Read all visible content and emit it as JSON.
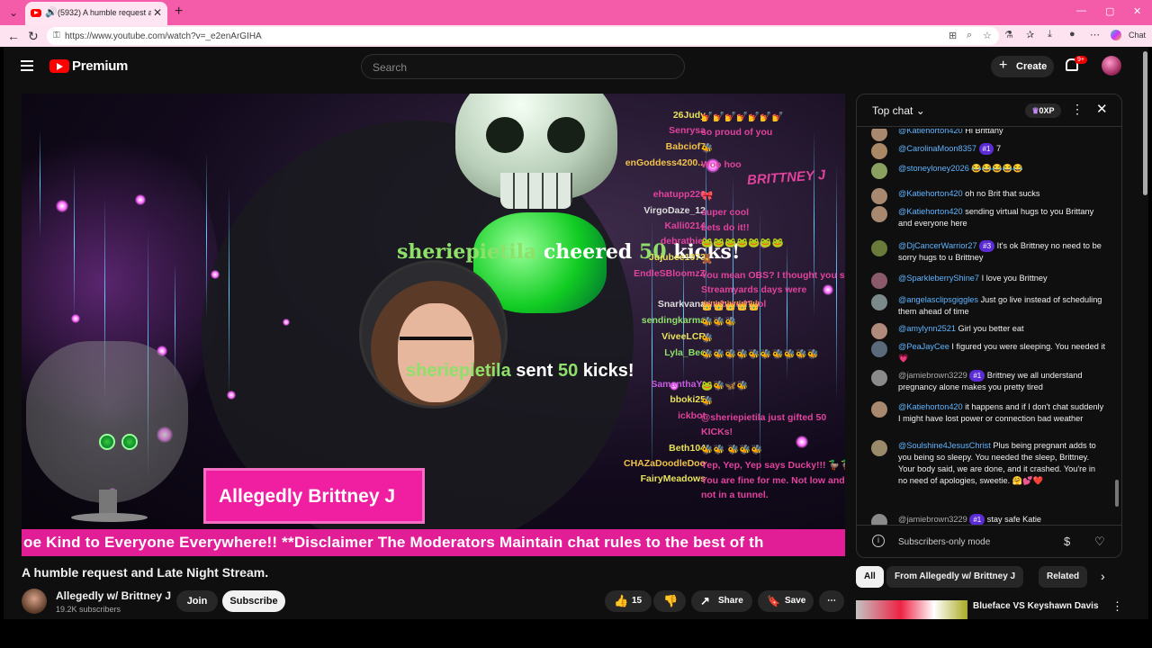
{
  "browser": {
    "tab_title": "(5932) A humble request and",
    "url": "https://www.youtube.com/watch?v=_e2enArGIHA",
    "copilot_label": "Chat"
  },
  "header": {
    "logo_text": "Premium",
    "search_placeholder": "Search",
    "create_label": "Create",
    "notification_count": "9+"
  },
  "video": {
    "cheer": {
      "user": "sheriepietila",
      "verb": "cheered",
      "amount": "50",
      "unit": "kicks!"
    },
    "sent": {
      "user": "sheriepietila",
      "verb": "sent",
      "amount": "50",
      "unit": "kicks!"
    },
    "name_banner": "Allegedly Brittney J",
    "ticker": "oe Kind to Everyone Everywhere!! **Disclaimer The Moderators Maintain chat rules to the best of th",
    "overlay_logo": "BRITTNEY J",
    "overlay_chat": [
      {
        "user": "26Judy",
        "color": "#e8e25a",
        "msg": "💅💅💅💅💅💅💅"
      },
      {
        "user": "Senrysa",
        "color": "#e0439c",
        "msg": "so proud of you"
      },
      {
        "user": "Babciof7",
        "color": "#f0c24a",
        "msg": "🐝"
      },
      {
        "user": "enGoddess4200...",
        "color": "#f0c24a",
        "msg": "Woo hoo"
      },
      {
        "user": "ehatupp226",
        "color": "#e0439c",
        "msg": "🎀"
      },
      {
        "user": "VirgoDaze_12",
        "color": "#dddddd",
        "msg": "super cool"
      },
      {
        "user": "Kalli0214",
        "color": "#e0439c",
        "msg": "Lets do it!!"
      },
      {
        "user": "debrathiel",
        "color": "#e0439c",
        "msg": "🐸🐸🐸🐸🐸🐸🐸"
      },
      {
        "user": "Jujubee1973",
        "color": "#e8e25a",
        "msg": "🧸"
      },
      {
        "user": "EndleSBloomzZ",
        "color": "#e0439c",
        "msg": "You mean OBS? I thought you said Streamyards days were numbered? lol"
      },
      {
        "user": "Snarkvana",
        "color": "#dddddd",
        "msg": "👑👑👑👑👑"
      },
      {
        "user": "sendingkarma",
        "color": "#8ee06a",
        "msg": "🐝🐝🐝"
      },
      {
        "user": "ViveeLCR",
        "color": "#e8e25a",
        "msg": "🐝"
      },
      {
        "user": "Lyla_Bee",
        "color": "#8ee06a",
        "msg": "🐝🐝🐝🐝🐝🐝🐝🐝🐝🐝"
      },
      {
        "user": "SamanthaYt",
        "color": "#c65ae0",
        "msg": "🐸🐝🦋🐝"
      },
      {
        "user": "bboki25",
        "color": "#e8e25a",
        "msg": "🐝"
      },
      {
        "user": "ickbot",
        "color": "#e0439c",
        "msg": "@sheriepietila just gifted 50 KICKs!"
      },
      {
        "user": "Beth104",
        "color": "#e8e25a",
        "msg": "🐝🐝 🐝🐝🐝"
      },
      {
        "user": "CHAZaDoodleDoo",
        "color": "#f0c24a",
        "msg": "Yep, Yep, Yep says Ducky!!! 🦆🦆"
      },
      {
        "user": "FairyMeadows",
        "color": "#e8e25a",
        "msg": "You are fine for me. Not low and not in a tunnel."
      }
    ],
    "title": "A humble request and Late Night Stream."
  },
  "channel": {
    "name": "Allegedly w/ Brittney J",
    "subscribers": "19.2K subscribers",
    "join_label": "Join",
    "subscribe_label": "Subscribe"
  },
  "actions": {
    "like_count": "15",
    "share_label": "Share",
    "save_label": "Save"
  },
  "chat": {
    "title": "Top chat",
    "xp": "0XP",
    "messages": [
      {
        "author": "@Katiehorton420",
        "badge": "",
        "text": "Hi Brittany",
        "avatar": "#a98870"
      },
      {
        "author": "@CarolinaMoon8357",
        "badge": "#1",
        "text": "7",
        "avatar": "#aa8866"
      },
      {
        "author": "@stoneyloney2026",
        "badge": "",
        "text": "😂😂😂😂😂",
        "avatar": "#8aa060"
      },
      {
        "author": "@Katiehorton420",
        "badge": "",
        "text": "oh no Brit that sucks",
        "avatar": "#a98870"
      },
      {
        "author": "@Katiehorton420",
        "badge": "",
        "text": "sending virtual hugs to you Brittany and everyone here",
        "avatar": "#a98870"
      },
      {
        "author": "@DjCancerWarrior27",
        "badge": "#3",
        "text": "It's ok Brittney no need to be sorry hugs to u Brittney",
        "avatar": "#6a7a3a"
      },
      {
        "author": "@SparkleberryShine7",
        "badge": "",
        "text": "I love you Brittney",
        "avatar": "#8a5a6a"
      },
      {
        "author": "@angelasclipsgiggles",
        "badge": "",
        "text": "Just go live instead of scheduling them ahead of time",
        "avatar": "#7a8a8a"
      },
      {
        "author": "@amylynn2521",
        "badge": "",
        "text": "Girl you better eat",
        "avatar": "#b08a7a"
      },
      {
        "author": "@PeaJayCee",
        "badge": "",
        "text": "I figured you were sleeping. You needed it 💗",
        "avatar": "#5a6a7a"
      },
      {
        "author": "@jamiebrown3229",
        "badge": "#1",
        "text": "Brittney we all understand pregnancy alone makes you pretty tired",
        "avatar": "#8a8a8a"
      },
      {
        "author": "@Katiehorton420",
        "badge": "",
        "text": "it happens and if I don't chat suddenly I might have lost power or connection bad weather",
        "avatar": "#a98870"
      },
      {
        "author": "@Soulshine4JesusChrist",
        "badge": "",
        "text": "Plus being pregnant adds to you being so sleepy. You needed the sleep, Brittney. Your body said, we are done, and it crashed. You're in no need of apologies, sweetie. 🤗💕❤️",
        "avatar": "#9a8a6a"
      },
      {
        "author": "@jamiebrown3229",
        "badge": "#1",
        "text": "stay safe Katie",
        "avatar": "#8a8a8a"
      }
    ],
    "footer_text": "Subscribers-only mode"
  },
  "chips": [
    {
      "label": "All"
    },
    {
      "label": "From Allegedly w/ Brittney J"
    },
    {
      "label": "Related"
    }
  ],
  "recommendation": {
    "title": "Blueface VS Keyshawn Davis"
  }
}
